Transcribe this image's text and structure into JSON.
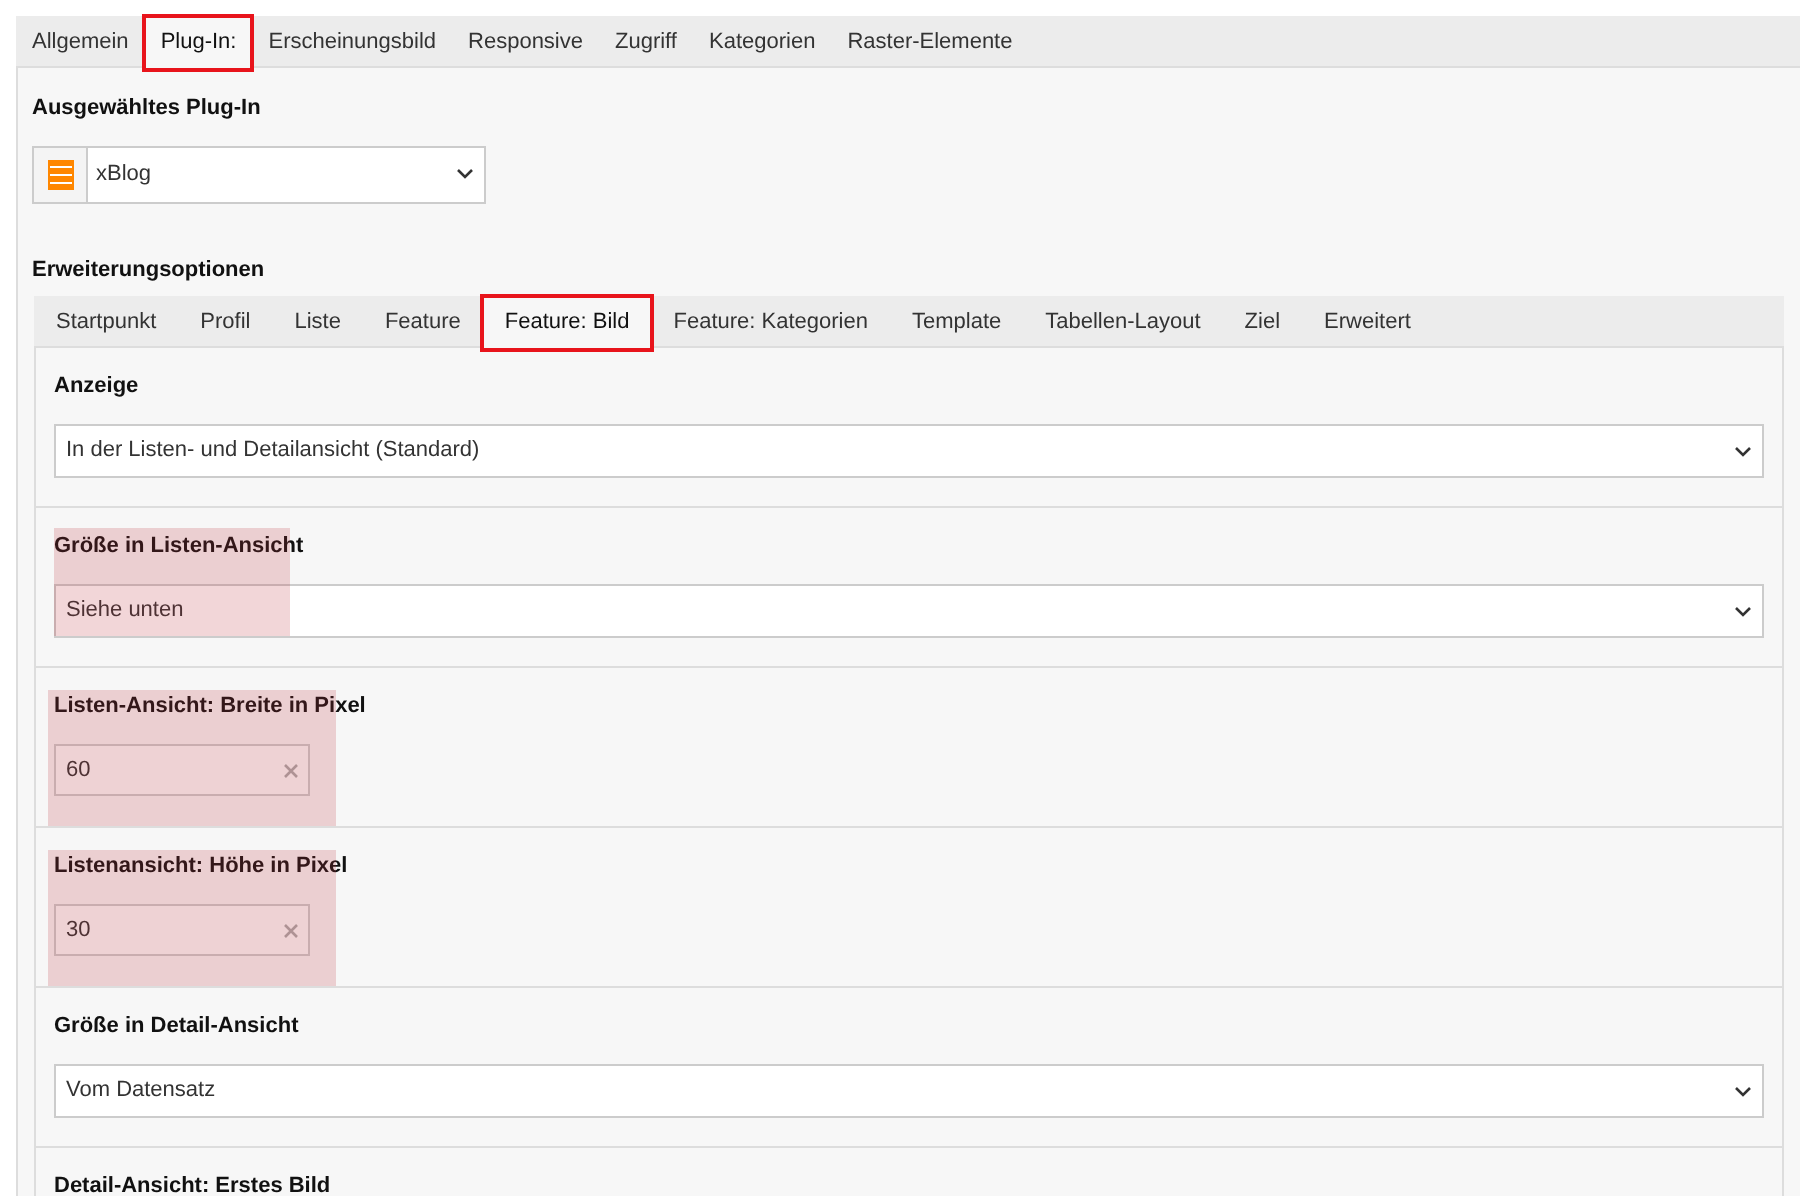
{
  "main_tabs": [
    {
      "label": "Allgemein",
      "selected": false,
      "marked": false
    },
    {
      "label": "Plug-In:",
      "selected": true,
      "marked": true
    },
    {
      "label": "Erscheinungsbild",
      "selected": false,
      "marked": false
    },
    {
      "label": "Responsive",
      "selected": false,
      "marked": false
    },
    {
      "label": "Zugriff",
      "selected": false,
      "marked": false
    },
    {
      "label": "Kategorien",
      "selected": false,
      "marked": false
    },
    {
      "label": "Raster-Elemente",
      "selected": false,
      "marked": false
    }
  ],
  "plugin": {
    "label": "Ausgewähltes Plug-In",
    "value": "xBlog"
  },
  "options": {
    "title": "Erweiterungsoptionen",
    "tabs": [
      {
        "label": "Startpunkt",
        "selected": false,
        "marked": false
      },
      {
        "label": "Profil",
        "selected": false,
        "marked": false
      },
      {
        "label": "Liste",
        "selected": false,
        "marked": false
      },
      {
        "label": "Feature",
        "selected": false,
        "marked": false
      },
      {
        "label": "Feature: Bild",
        "selected": true,
        "marked": true
      },
      {
        "label": "Feature: Kategorien",
        "selected": false,
        "marked": false
      },
      {
        "label": "Template",
        "selected": false,
        "marked": false
      },
      {
        "label": "Tabellen-Layout",
        "selected": false,
        "marked": false
      },
      {
        "label": "Ziel",
        "selected": false,
        "marked": false
      },
      {
        "label": "Erweitert",
        "selected": false,
        "marked": false
      }
    ],
    "fields": [
      {
        "kind": "select",
        "label": "Anzeige",
        "value": "In der Listen- und Detailansicht (Standard)",
        "highlighted": false
      },
      {
        "kind": "select",
        "label": "Größe in Listen-Ansicht",
        "value": "Siehe unten",
        "highlighted": true
      },
      {
        "kind": "text",
        "label": "Listen-Ansicht: Breite in Pixel",
        "value": "60",
        "highlighted": true
      },
      {
        "kind": "text",
        "label": "Listenansicht: Höhe in Pixel",
        "value": "30",
        "highlighted": true
      },
      {
        "kind": "select",
        "label": "Größe in Detail-Ansicht",
        "value": "Vom Datensatz",
        "highlighted": false
      },
      {
        "kind": "heading",
        "label": "Detail-Ansicht: Erstes Bild",
        "highlighted": false
      }
    ]
  }
}
